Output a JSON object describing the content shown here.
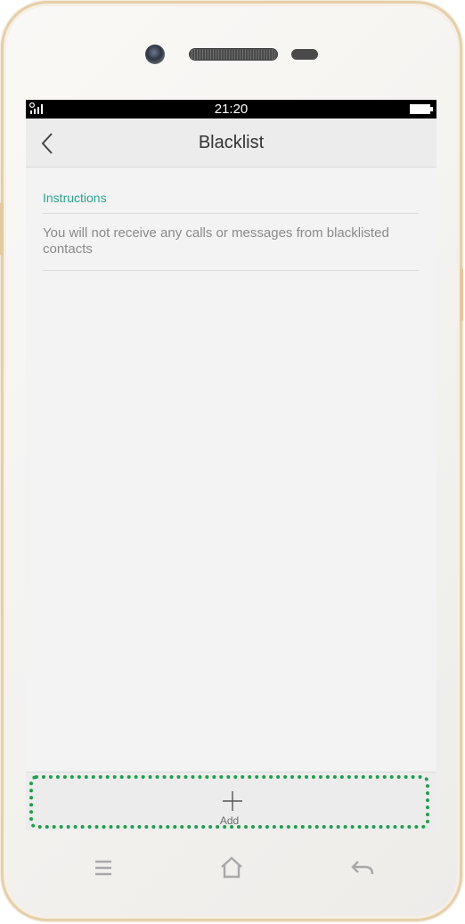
{
  "status_bar": {
    "time": "21:20",
    "signal_icon": "signal-icon",
    "battery_icon": "battery-icon"
  },
  "header": {
    "title": "Blacklist",
    "back_icon": "chevron-left-icon"
  },
  "instructions": {
    "heading": "Instructions",
    "text": "You will not receive any calls or messages from blacklisted contacts"
  },
  "bottom_action": {
    "label": "Add",
    "icon": "plus-icon"
  },
  "nav_keys": {
    "menu_icon": "menu-icon",
    "home_icon": "home-icon",
    "back_icon": "back-arrow-icon"
  },
  "colors": {
    "accent": "#2aa38f",
    "highlight": "#1f9e4a",
    "screen_bg": "#f3f3f3",
    "bar_bg": "#ececec",
    "frame": "#e6cfa9"
  }
}
